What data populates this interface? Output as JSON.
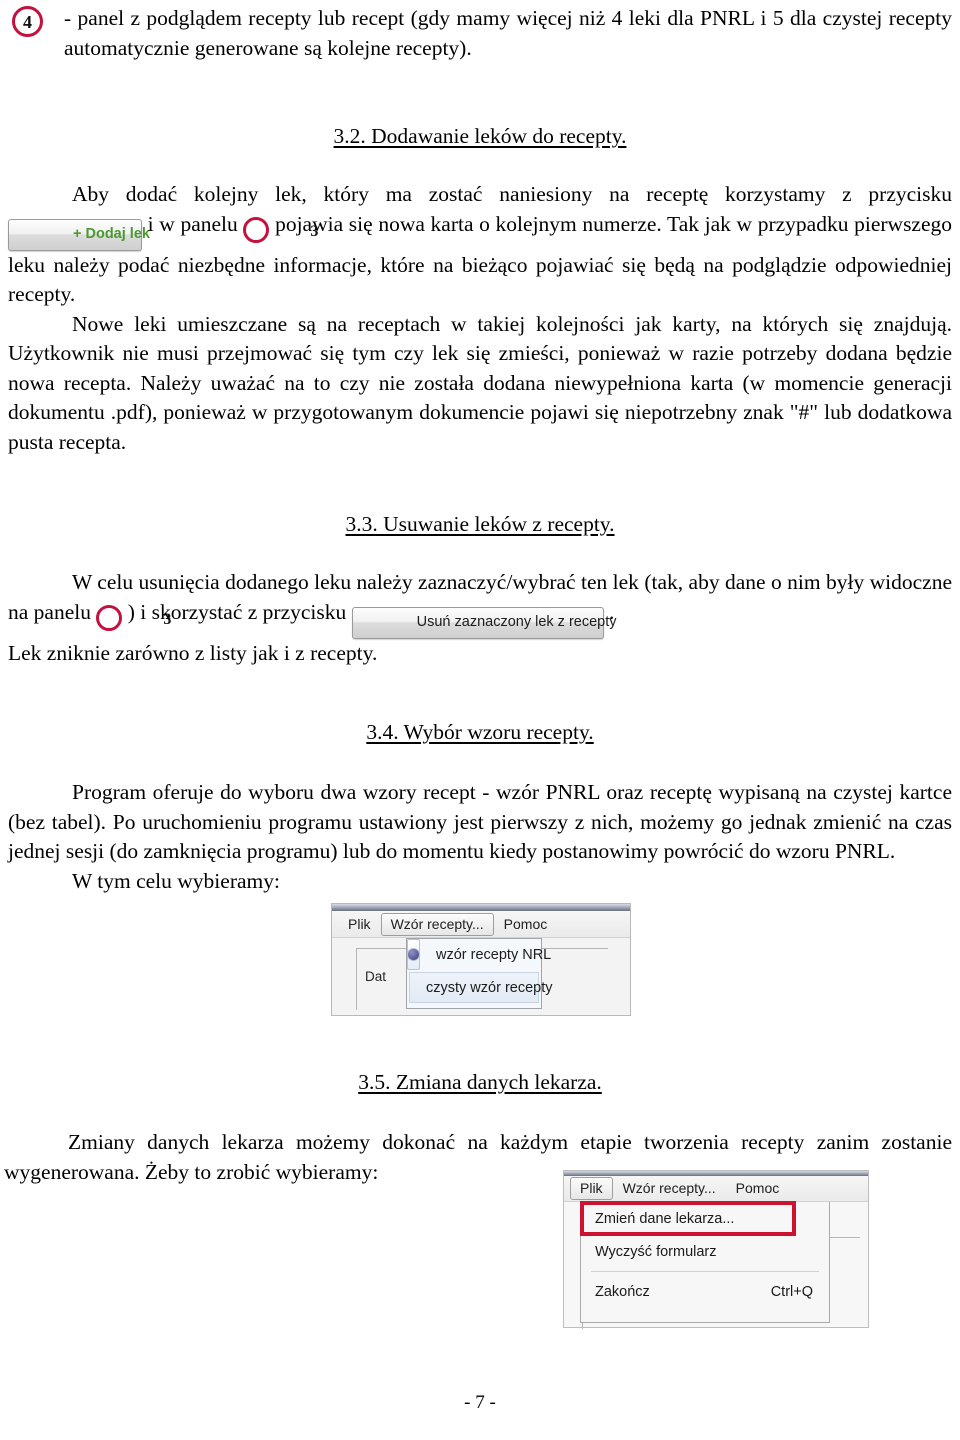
{
  "markers": {
    "four": "4",
    "three": "3"
  },
  "intro": {
    "text": "- panel z podglądem recepty lub recept (gdy mamy więcej niż 4 leki dla PNRL i 5 dla czystej recepty automatycznie generowane są kolejne recepty)."
  },
  "sections": {
    "s32": {
      "heading": "3.2. Dodawanie leków do recepty.",
      "p1_a": "Aby dodać kolejny lek, który ma zostać naniesiony na receptę korzystamy z przycisku",
      "btn_dodaj_lek": "+ Dodaj lek",
      "p1_b": "i w panelu",
      "p1_c": "pojawia się nowa karta o kolejnym numerze. Tak jak w przypadku pierwszego leku należy podać niezbędne informacje, które na bieżąco pojawiać się będą na podglądzie odpowiedniej recepty.",
      "p2": "Nowe leki umieszczane są na receptach w takiej kolejności jak karty, na których się znajdują. Użytkownik nie musi przejmować się tym czy lek się zmieści, ponieważ w razie potrzeby dodana będzie nowa recepta. Należy uważać na to czy nie została dodana niewypełniona karta (w momencie generacji dokumentu .pdf), ponieważ w przygotowanym dokumencie pojawi się niepotrzebny znak \"#\" lub dodatkowa pusta recepta."
    },
    "s33": {
      "heading": "3.3. Usuwanie leków z recepty.",
      "p1_a": "W celu usunięcia dodanego leku należy zaznaczyć/wybrać ten lek (tak, aby dane o nim były widoczne na panelu",
      "p1_b": ") i skorzystać z przycisku",
      "btn_usun": "Usuń zaznaczony lek z recepty",
      "p1_c": ".",
      "p2": "Lek zniknie zarówno z listy jak i z recepty."
    },
    "s34": {
      "heading": "3.4. Wybór wzoru recepty.",
      "p1": "Program oferuje do wyboru dwa wzory recept - wzór PNRL oraz receptę wypisaną na czystej kartce (bez tabel). Po uruchomieniu programu ustawiony jest pierwszy z nich, możemy go jednak zmienić na czas jednej sesji (do zamknięcia programu) lub do momentu kiedy postanowimy powrócić do wzoru PNRL.",
      "p2": "W tym celu wybieramy:"
    },
    "s35": {
      "heading": "3.5. Zmiana danych lekarza.",
      "p1": "Zmiany danych lekarza możemy dokonać na każdym etapie tworzenia recepty zanim zostanie wygenerowana. Żeby to zrobić wybieramy:"
    }
  },
  "app_menu": {
    "bar": [
      "Plik",
      "Wzór recepty...",
      "Pomoc"
    ],
    "wzor_popup": {
      "items": [
        {
          "label": "wzór recepty NRL",
          "selected": true
        },
        {
          "label": "czysty wzór recepty",
          "selected": false
        }
      ]
    },
    "plik_popup": {
      "items": [
        {
          "label": "Zmień dane lekarza...",
          "accel": "",
          "highlighted": true
        },
        {
          "label": "Wyczyść formularz",
          "accel": "",
          "highlighted": false
        },
        {
          "label": "Zakończ",
          "accel": "Ctrl+Q",
          "highlighted": false
        }
      ]
    },
    "form_field_label": "Dat"
  },
  "colors": {
    "marker_red": "#c4123f",
    "highlight_red": "#cc1430",
    "button_green": "#4a9a2f"
  },
  "footer": {
    "page_number": "- 7 -"
  }
}
